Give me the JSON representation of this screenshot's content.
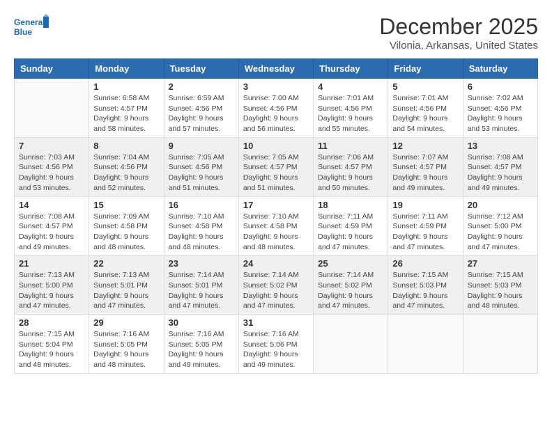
{
  "logo": {
    "line1": "General",
    "line2": "Blue"
  },
  "title": "December 2025",
  "location": "Vilonia, Arkansas, United States",
  "days_of_week": [
    "Sunday",
    "Monday",
    "Tuesday",
    "Wednesday",
    "Thursday",
    "Friday",
    "Saturday"
  ],
  "weeks": [
    [
      {
        "day": "",
        "info": ""
      },
      {
        "day": "1",
        "info": "Sunrise: 6:58 AM\nSunset: 4:57 PM\nDaylight: 9 hours\nand 58 minutes."
      },
      {
        "day": "2",
        "info": "Sunrise: 6:59 AM\nSunset: 4:56 PM\nDaylight: 9 hours\nand 57 minutes."
      },
      {
        "day": "3",
        "info": "Sunrise: 7:00 AM\nSunset: 4:56 PM\nDaylight: 9 hours\nand 56 minutes."
      },
      {
        "day": "4",
        "info": "Sunrise: 7:01 AM\nSunset: 4:56 PM\nDaylight: 9 hours\nand 55 minutes."
      },
      {
        "day": "5",
        "info": "Sunrise: 7:01 AM\nSunset: 4:56 PM\nDaylight: 9 hours\nand 54 minutes."
      },
      {
        "day": "6",
        "info": "Sunrise: 7:02 AM\nSunset: 4:56 PM\nDaylight: 9 hours\nand 53 minutes."
      }
    ],
    [
      {
        "day": "7",
        "info": "Sunrise: 7:03 AM\nSunset: 4:56 PM\nDaylight: 9 hours\nand 53 minutes."
      },
      {
        "day": "8",
        "info": "Sunrise: 7:04 AM\nSunset: 4:56 PM\nDaylight: 9 hours\nand 52 minutes."
      },
      {
        "day": "9",
        "info": "Sunrise: 7:05 AM\nSunset: 4:56 PM\nDaylight: 9 hours\nand 51 minutes."
      },
      {
        "day": "10",
        "info": "Sunrise: 7:05 AM\nSunset: 4:57 PM\nDaylight: 9 hours\nand 51 minutes."
      },
      {
        "day": "11",
        "info": "Sunrise: 7:06 AM\nSunset: 4:57 PM\nDaylight: 9 hours\nand 50 minutes."
      },
      {
        "day": "12",
        "info": "Sunrise: 7:07 AM\nSunset: 4:57 PM\nDaylight: 9 hours\nand 49 minutes."
      },
      {
        "day": "13",
        "info": "Sunrise: 7:08 AM\nSunset: 4:57 PM\nDaylight: 9 hours\nand 49 minutes."
      }
    ],
    [
      {
        "day": "14",
        "info": "Sunrise: 7:08 AM\nSunset: 4:57 PM\nDaylight: 9 hours\nand 49 minutes."
      },
      {
        "day": "15",
        "info": "Sunrise: 7:09 AM\nSunset: 4:58 PM\nDaylight: 9 hours\nand 48 minutes."
      },
      {
        "day": "16",
        "info": "Sunrise: 7:10 AM\nSunset: 4:58 PM\nDaylight: 9 hours\nand 48 minutes."
      },
      {
        "day": "17",
        "info": "Sunrise: 7:10 AM\nSunset: 4:58 PM\nDaylight: 9 hours\nand 48 minutes."
      },
      {
        "day": "18",
        "info": "Sunrise: 7:11 AM\nSunset: 4:59 PM\nDaylight: 9 hours\nand 47 minutes."
      },
      {
        "day": "19",
        "info": "Sunrise: 7:11 AM\nSunset: 4:59 PM\nDaylight: 9 hours\nand 47 minutes."
      },
      {
        "day": "20",
        "info": "Sunrise: 7:12 AM\nSunset: 5:00 PM\nDaylight: 9 hours\nand 47 minutes."
      }
    ],
    [
      {
        "day": "21",
        "info": "Sunrise: 7:13 AM\nSunset: 5:00 PM\nDaylight: 9 hours\nand 47 minutes."
      },
      {
        "day": "22",
        "info": "Sunrise: 7:13 AM\nSunset: 5:01 PM\nDaylight: 9 hours\nand 47 minutes."
      },
      {
        "day": "23",
        "info": "Sunrise: 7:14 AM\nSunset: 5:01 PM\nDaylight: 9 hours\nand 47 minutes."
      },
      {
        "day": "24",
        "info": "Sunrise: 7:14 AM\nSunset: 5:02 PM\nDaylight: 9 hours\nand 47 minutes."
      },
      {
        "day": "25",
        "info": "Sunrise: 7:14 AM\nSunset: 5:02 PM\nDaylight: 9 hours\nand 47 minutes."
      },
      {
        "day": "26",
        "info": "Sunrise: 7:15 AM\nSunset: 5:03 PM\nDaylight: 9 hours\nand 47 minutes."
      },
      {
        "day": "27",
        "info": "Sunrise: 7:15 AM\nSunset: 5:03 PM\nDaylight: 9 hours\nand 48 minutes."
      }
    ],
    [
      {
        "day": "28",
        "info": "Sunrise: 7:15 AM\nSunset: 5:04 PM\nDaylight: 9 hours\nand 48 minutes."
      },
      {
        "day": "29",
        "info": "Sunrise: 7:16 AM\nSunset: 5:05 PM\nDaylight: 9 hours\nand 48 minutes."
      },
      {
        "day": "30",
        "info": "Sunrise: 7:16 AM\nSunset: 5:05 PM\nDaylight: 9 hours\nand 49 minutes."
      },
      {
        "day": "31",
        "info": "Sunrise: 7:16 AM\nSunset: 5:06 PM\nDaylight: 9 hours\nand 49 minutes."
      },
      {
        "day": "",
        "info": ""
      },
      {
        "day": "",
        "info": ""
      },
      {
        "day": "",
        "info": ""
      }
    ]
  ]
}
